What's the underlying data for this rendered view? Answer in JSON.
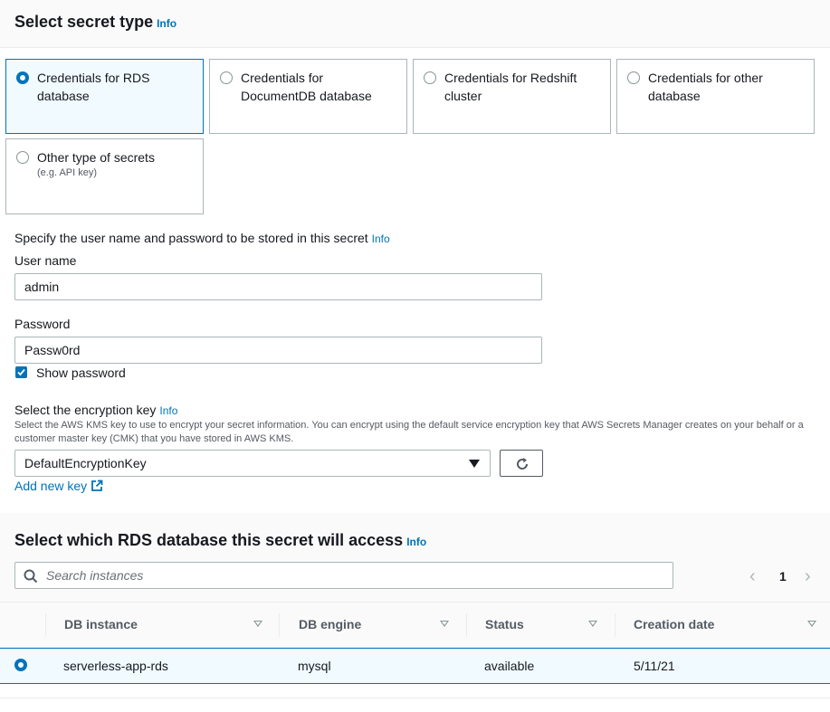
{
  "secret_type": {
    "title": "Select secret type",
    "info": "Info",
    "options": [
      {
        "label": "Credentials for RDS database",
        "desc": "",
        "selected": true
      },
      {
        "label": "Credentials for DocumentDB database",
        "desc": "",
        "selected": false
      },
      {
        "label": "Credentials for Redshift cluster",
        "desc": "",
        "selected": false
      },
      {
        "label": "Credentials for other database",
        "desc": "",
        "selected": false
      },
      {
        "label": "Other type of secrets",
        "desc": "(e.g. API key)",
        "selected": false
      }
    ]
  },
  "credentials": {
    "heading": "Specify the user name and password to be stored in this secret",
    "info": "Info",
    "username_label": "User name",
    "username_value": "admin",
    "password_label": "Password",
    "password_value": "Passw0rd",
    "show_password_label": "Show password",
    "show_password_checked": true
  },
  "encryption": {
    "label": "Select the encryption key",
    "info": "Info",
    "help": "Select the AWS KMS key to use to encrypt your secret information. You can encrypt using the default service encryption key that AWS Secrets Manager creates on your behalf or a customer master key (CMK) that you have stored in AWS KMS.",
    "selected": "DefaultEncryptionKey",
    "add_new_key": "Add new key",
    "icons": [
      "caret-down-icon",
      "refresh-icon",
      "external-link-icon"
    ]
  },
  "rds": {
    "title": "Select which RDS database this secret will access",
    "info": "Info",
    "search_placeholder": "Search instances",
    "page": "1",
    "columns": [
      "DB instance",
      "DB engine",
      "Status",
      "Creation date"
    ],
    "rows": [
      {
        "instance": "serverless-app-rds",
        "engine": "mysql",
        "status": "available",
        "created": "5/11/21",
        "selected": true
      }
    ]
  },
  "colors": {
    "accent": "#0073bb",
    "selected_bg": "#f1faff",
    "border": "#aab7b8"
  }
}
